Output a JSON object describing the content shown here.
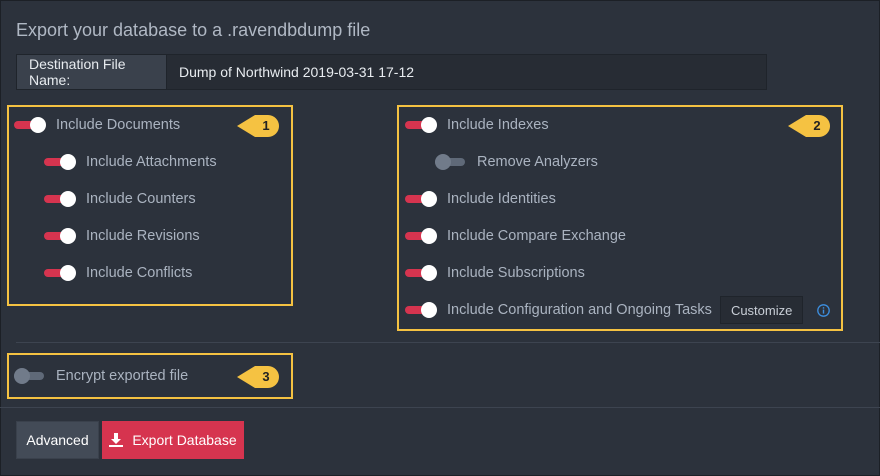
{
  "title": "Export your database to a .ravendbdump file",
  "destination": {
    "label": "Destination File Name:",
    "value": "Dump of Northwind 2019-03-31 17-12"
  },
  "left_options": [
    {
      "label": "Include Documents",
      "on": true
    },
    {
      "label": "Include Attachments",
      "on": true
    },
    {
      "label": "Include Counters",
      "on": true
    },
    {
      "label": "Include Revisions",
      "on": true
    },
    {
      "label": "Include Conflicts",
      "on": true
    }
  ],
  "right_options": [
    {
      "label": "Include Indexes",
      "on": true
    },
    {
      "label": "Remove Analyzers",
      "on": false
    },
    {
      "label": "Include Identities",
      "on": true
    },
    {
      "label": "Include Compare Exchange",
      "on": true
    },
    {
      "label": "Include Subscriptions",
      "on": true
    },
    {
      "label": "Include Configuration and Ongoing Tasks",
      "on": true
    }
  ],
  "customize_label": "Customize",
  "encrypt": {
    "label": "Encrypt exported file",
    "on": false
  },
  "callouts": [
    "1",
    "2",
    "3"
  ],
  "buttons": {
    "advanced": "Advanced",
    "export": "Export Database"
  },
  "colors": {
    "accent": "#d6344f",
    "highlight": "#f5c242",
    "background": "#2c323c",
    "info": "#3d8fe0"
  },
  "icons": {
    "export": "download-icon",
    "info": "info-icon"
  }
}
